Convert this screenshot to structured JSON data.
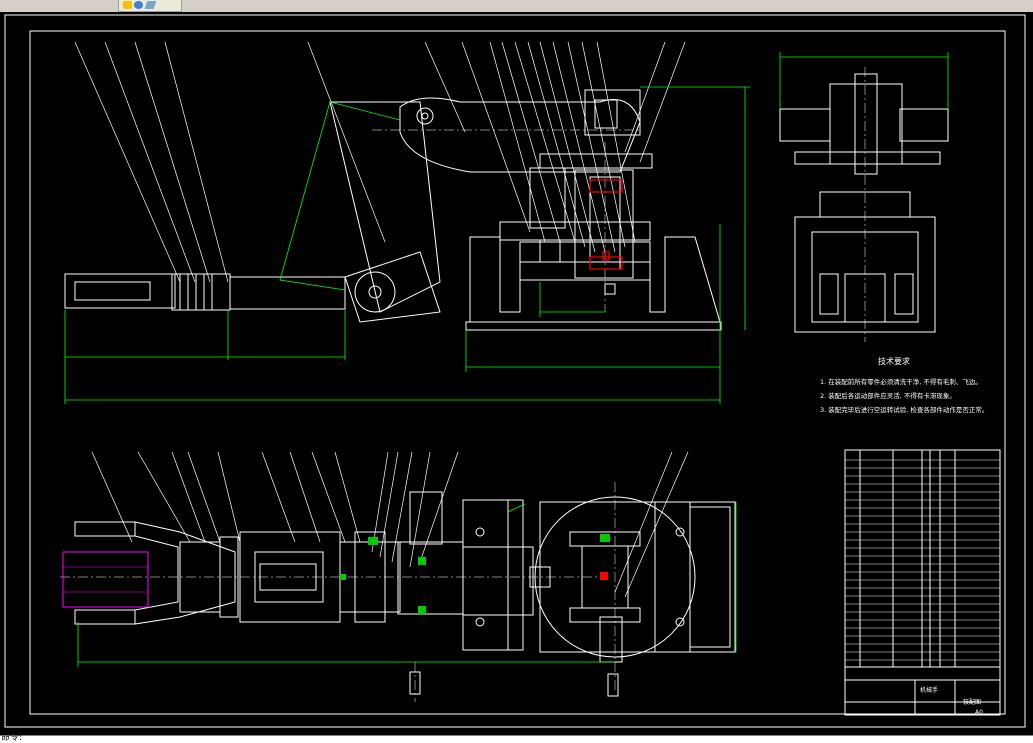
{
  "app": {
    "toolbar_icons": [
      "folder-icon",
      "globe-icon",
      "layer-icon"
    ]
  },
  "drawing": {
    "requirements_title": "技术要求",
    "requirements": [
      "1. 在装配前所有零件必须清洗干净, 不得有毛刺、飞边。",
      "2. 装配后各运动部件应灵活, 不得有卡滞现象。",
      "3. 装配完毕后进行空运转试验, 检查各部件动作是否正常。"
    ],
    "title_block": {
      "drawing_name": "机械手",
      "company": "装配图",
      "scale": "A0"
    }
  },
  "status": {
    "command_prompt": "命令:"
  },
  "colors": {
    "canvas": "#000000",
    "line_white": "#ffffff",
    "line_green": "#00ff00",
    "line_red": "#ff0000",
    "line_magenta": "#ff00ff"
  }
}
